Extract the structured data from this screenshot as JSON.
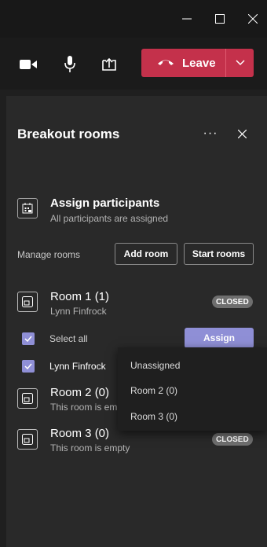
{
  "window": {
    "minimize_icon": "minimize-icon",
    "maximize_icon": "maximize-icon",
    "close_icon": "close-icon"
  },
  "controls": {
    "camera_icon": "camera-icon",
    "mic_icon": "microphone-icon",
    "share_icon": "share-screen-icon",
    "leave_label": "Leave",
    "leave_color": "#c4314b"
  },
  "panel": {
    "title": "Breakout rooms",
    "more_icon": "more-options-icon",
    "more_glyph": "···",
    "assign": {
      "title": "Assign participants",
      "subtitle": "All participants are assigned"
    },
    "manage": {
      "label": "Manage rooms",
      "add_room": "Add room",
      "start_rooms": "Start rooms"
    },
    "rooms": [
      {
        "name": "Room 1 (1)",
        "subtitle": "Lynn Finfrock",
        "status": "CLOSED"
      },
      {
        "name": "Room 2 (0)",
        "subtitle": "This room is em"
      },
      {
        "name": "Room 3 (0)",
        "subtitle": "This room is empty",
        "status": "CLOSED"
      }
    ],
    "select_all": "Select all",
    "assign_button": "Assign",
    "participant": "Lynn Finfrock",
    "accent_color": "#8f8fd6",
    "dropdown": [
      "Unassigned",
      "Room 2 (0)",
      "Room 3 (0)"
    ]
  }
}
